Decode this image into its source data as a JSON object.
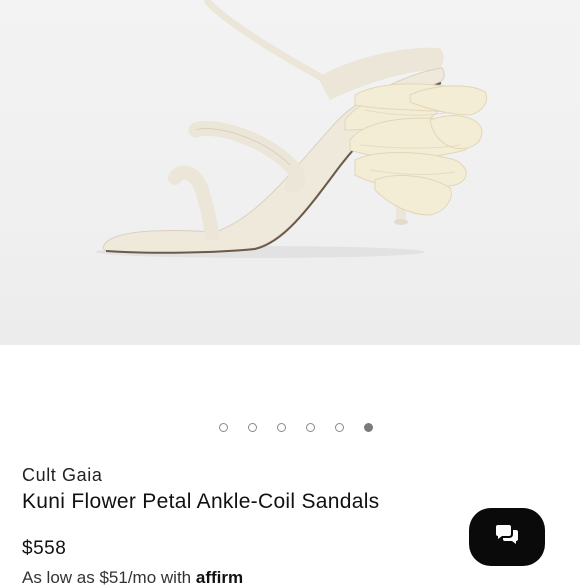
{
  "product": {
    "brand": "Cult Gaia",
    "title": "Kuni Flower Petal Ankle-Coil Sandals",
    "price": "$558",
    "financing_text": "As low as $51/mo with ",
    "financing_brand": "affirm"
  },
  "gallery": {
    "image_count": 6,
    "active_index": 5,
    "dots": [
      "1",
      "2",
      "3",
      "4",
      "5",
      "6"
    ]
  },
  "icons": {
    "chat": "chat-bubbles-icon"
  },
  "colors": {
    "hero_bg": "#f0f0f0",
    "sandal": "#efe9dc",
    "flower": "#f4edd6",
    "chat_button": "#0a0a0a",
    "dot_active": "#7a7a7a"
  }
}
